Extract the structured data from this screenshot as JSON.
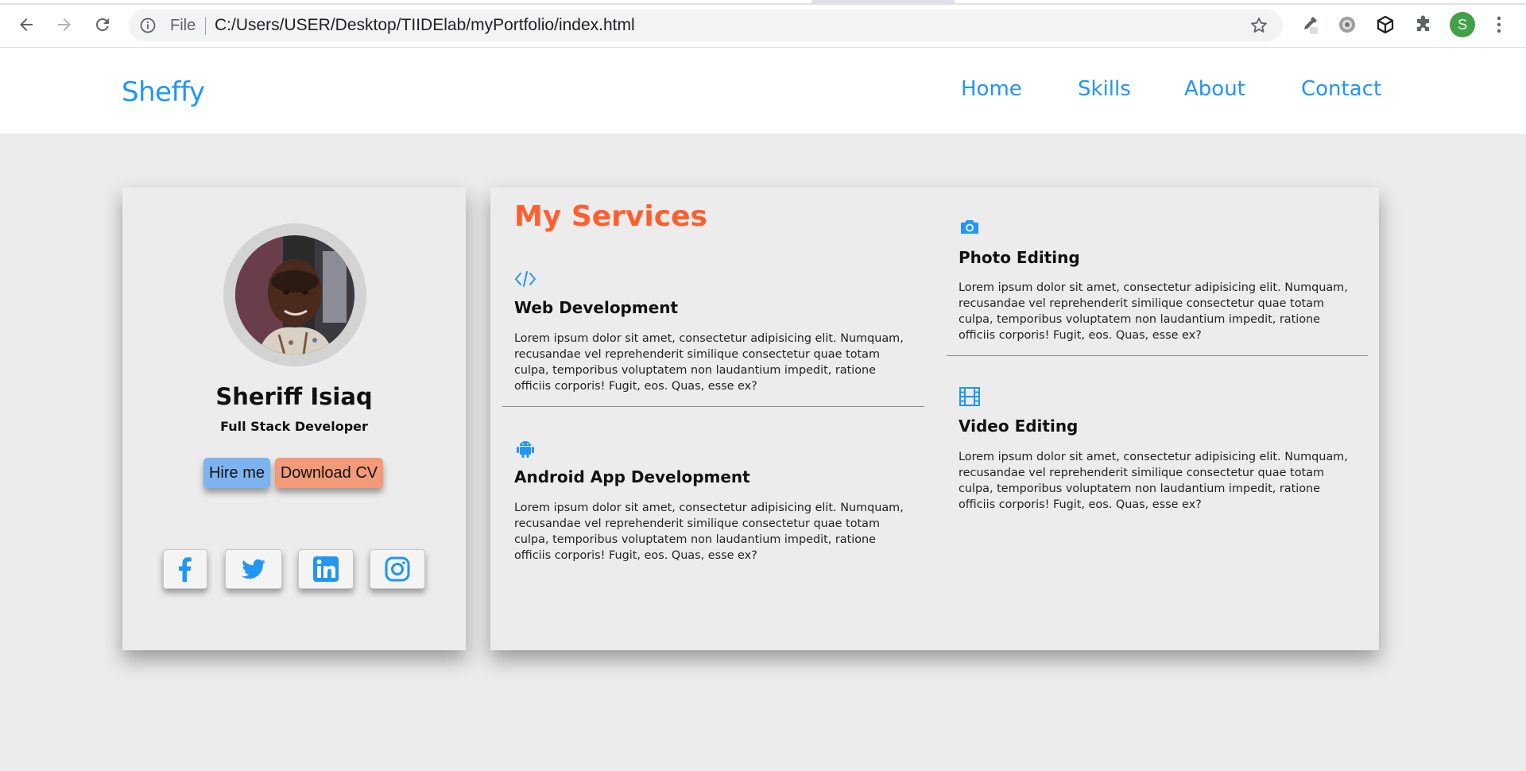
{
  "browser": {
    "file_label": "File",
    "url": "C:/Users/USER/Desktop/TIIDElab/myPortfolio/index.html",
    "profile_initial": "S"
  },
  "site": {
    "logo": "Sheffy",
    "nav": [
      "Home",
      "Skills",
      "About",
      "Contact"
    ]
  },
  "profile": {
    "name": "Sheriff Isiaq",
    "role": "Full Stack Developer",
    "hire_label": "Hire me",
    "cv_label": "Download CV",
    "social_icons": [
      "facebook-icon",
      "twitter-icon",
      "linkedin-icon",
      "instagram-icon"
    ]
  },
  "services": {
    "title": "My Services",
    "items": [
      {
        "icon": "code-icon",
        "title": "Web Development",
        "text": "Lorem ipsum dolor sit amet, consectetur adipisicing elit. Numquam, recusandae vel reprehenderit similique consectetur quae totam culpa, temporibus voluptatem non laudantium impedit, ratione officiis corporis! Fugit, eos. Quas, esse ex?"
      },
      {
        "icon": "android-icon",
        "title": "Android App Development",
        "text": "Lorem ipsum dolor sit amet, consectetur adipisicing elit. Numquam, recusandae vel reprehenderit similique consectetur quae totam culpa, temporibus voluptatem non laudantium impedit, ratione officiis corporis! Fugit, eos. Quas, esse ex?"
      },
      {
        "icon": "camera-icon",
        "title": "Photo Editing",
        "text": "Lorem ipsum dolor sit amet, consectetur adipisicing elit. Numquam, recusandae vel reprehenderit similique consectetur quae totam culpa, temporibus voluptatem non laudantium impedit, ratione officiis corporis! Fugit, eos. Quas, esse ex?"
      },
      {
        "icon": "film-icon",
        "title": "Video Editing",
        "text": "Lorem ipsum dolor sit amet, consectetur adipisicing elit. Numquam, recusandae vel reprehenderit similique consectetur quae totam culpa, temporibus voluptatem non laudantium impedit, ratione officiis corporis! Fugit, eos. Quas, esse ex?"
      }
    ]
  },
  "colors": {
    "accent": "#2196f3",
    "title_orange": "#ff5e2e",
    "hire_button": "#7db4f0",
    "cv_button": "#f39a78",
    "background": "#ececec"
  }
}
